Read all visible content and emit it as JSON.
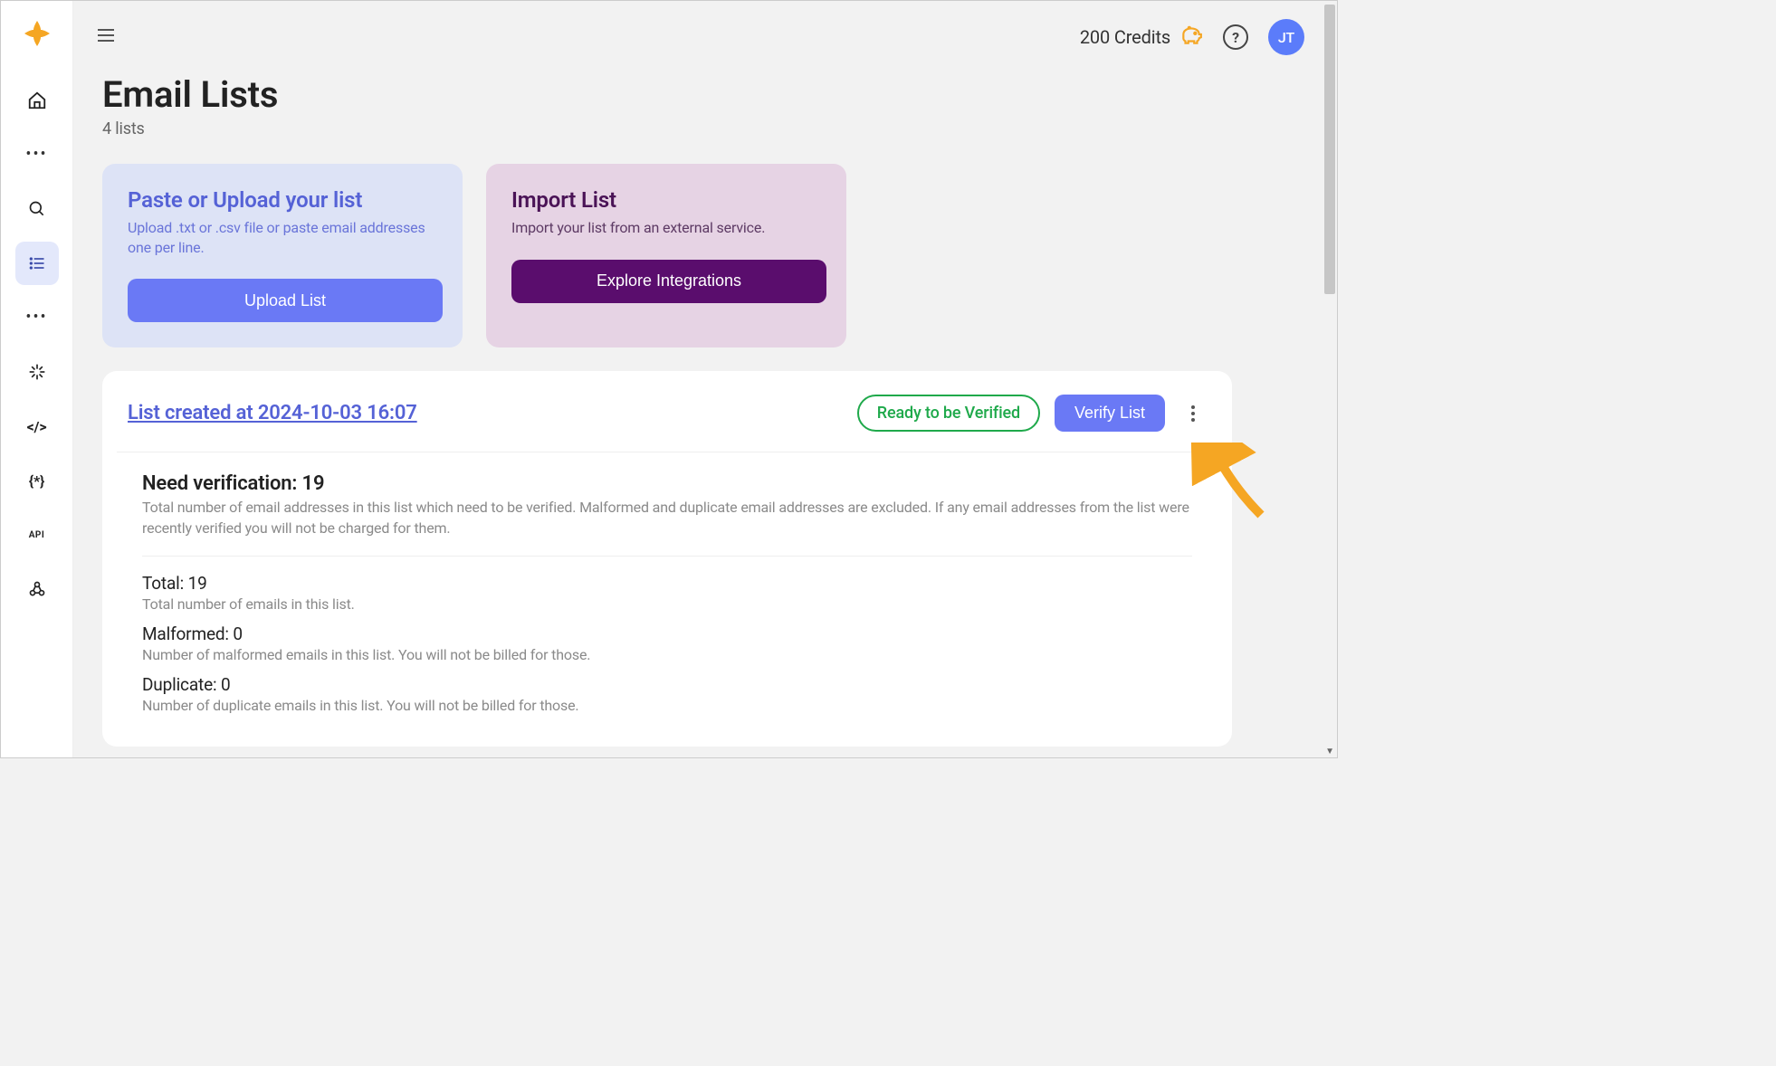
{
  "topbar": {
    "credits_label": "200 Credits",
    "avatar_initials": "JT"
  },
  "page": {
    "title": "Email Lists",
    "subtitle": "4 lists"
  },
  "upload_card": {
    "title": "Paste or Upload your list",
    "desc": "Upload .txt or .csv file or paste email addresses one per line.",
    "button": "Upload List"
  },
  "import_card": {
    "title": "Import List",
    "desc": "Import your list from an external service.",
    "button": "Explore Integrations"
  },
  "list": {
    "link_label": "List created at 2024-10-03 16:07",
    "status": "Ready to be Verified",
    "verify_button": "Verify List"
  },
  "stats": {
    "need_verification": {
      "title": "Need verification: 19",
      "desc": "Total number of email addresses in this list which need to be verified. Malformed and duplicate email addresses are excluded. If any email addresses from the list were recently verified you will not be charged for them."
    },
    "total": {
      "title": "Total: 19",
      "desc": "Total number of emails in this list."
    },
    "malformed": {
      "title": "Malformed: 0",
      "desc": "Number of malformed emails in this list. You will not be billed for those."
    },
    "duplicate": {
      "title": "Duplicate: 0",
      "desc": "Number of duplicate emails in this list. You will not be billed for those."
    }
  }
}
